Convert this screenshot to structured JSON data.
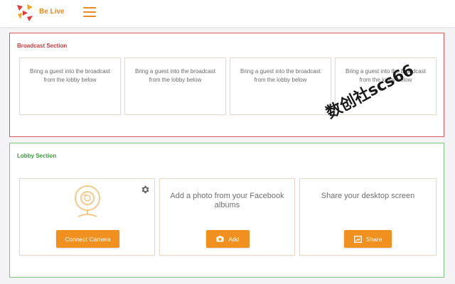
{
  "header": {
    "brand_name": "Be Live",
    "accent_color": "#e88a1f",
    "menu_icon": "hamburger-icon"
  },
  "broadcast": {
    "title": "Broadcast Section",
    "border_color": "#d65a5a",
    "slots": [
      {
        "text": "Bring a guest into the broadcast from the lobby below"
      },
      {
        "text": "Bring a guest into the broadcast from the lobby below"
      },
      {
        "text": "Bring a guest into the broadcast from the lobby below"
      },
      {
        "text": "Bring a guest into the broadcast from the lobby below"
      }
    ]
  },
  "lobby": {
    "title": "Lobby Section",
    "border_color": "#7dc47d",
    "camera": {
      "icon": "webcam-icon",
      "settings_icon": "gear-icon",
      "button_label": "Connect Camera"
    },
    "facebook": {
      "text": "Add a photo from your Facebook albums",
      "button_icon": "camera-icon",
      "button_label": "Add"
    },
    "desktop": {
      "text": "Share your desktop screen",
      "button_icon": "screen-share-icon",
      "button_label": "Share"
    }
  },
  "button_color": "#f0901f",
  "watermark": "数创社scs66"
}
